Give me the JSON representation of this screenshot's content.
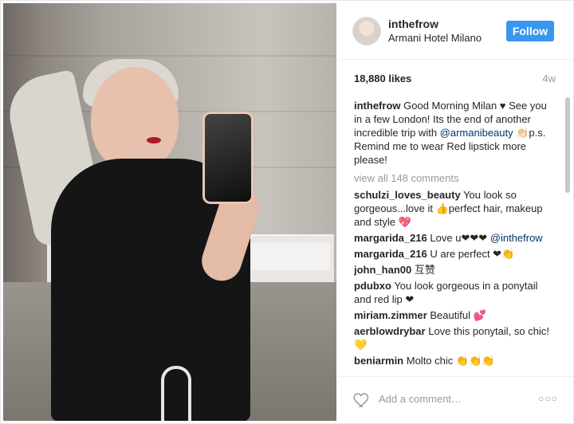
{
  "post": {
    "username": "inthefrow",
    "location": "Armani Hotel Milano",
    "follow_label": "Follow",
    "likes": "18,880 likes",
    "age": "4w",
    "caption_user": "inthefrow",
    "caption_text_1": "Good Morning Milan ♥ See you in a few London! Its the end of another incredible trip with ",
    "caption_mention": "@armanibeauty",
    "caption_text_2": " 👏🏻p.s. Remind me to wear Red lipstick more please!",
    "view_all": "view all 148 comments"
  },
  "comments": [
    {
      "user": "schulzi_loves_beauty",
      "text": "You look so gorgeous...love it 👍perfect hair, makeup and style 💖",
      "mention": ""
    },
    {
      "user": "margarida_216",
      "text": "Love u❤❤❤",
      "mention": "@inthefrow"
    },
    {
      "user": "margarida_216",
      "text": "U are perfect ❤👏",
      "mention": ""
    },
    {
      "user": "john_han00",
      "text": "互赞",
      "mention": ""
    },
    {
      "user": "pdubxo",
      "text": "You look gorgeous in a ponytail and red lip ❤",
      "mention": ""
    },
    {
      "user": "miriam.zimmer",
      "text": "Beautiful 💕",
      "mention": ""
    },
    {
      "user": "aerblowdrybar",
      "text": "Love this ponytail, so chic! 💛",
      "mention": ""
    },
    {
      "user": "beniarmin",
      "text": "Molto chic 👏👏👏",
      "mention": ""
    }
  ],
  "footer": {
    "add_comment_placeholder": "Add a comment…",
    "more": "○○○"
  },
  "icons": {
    "heart": "heart-icon",
    "more": "more-options-icon"
  },
  "colors": {
    "follow_button": "#3897f0",
    "mention": "#003569",
    "muted": "#999999"
  }
}
